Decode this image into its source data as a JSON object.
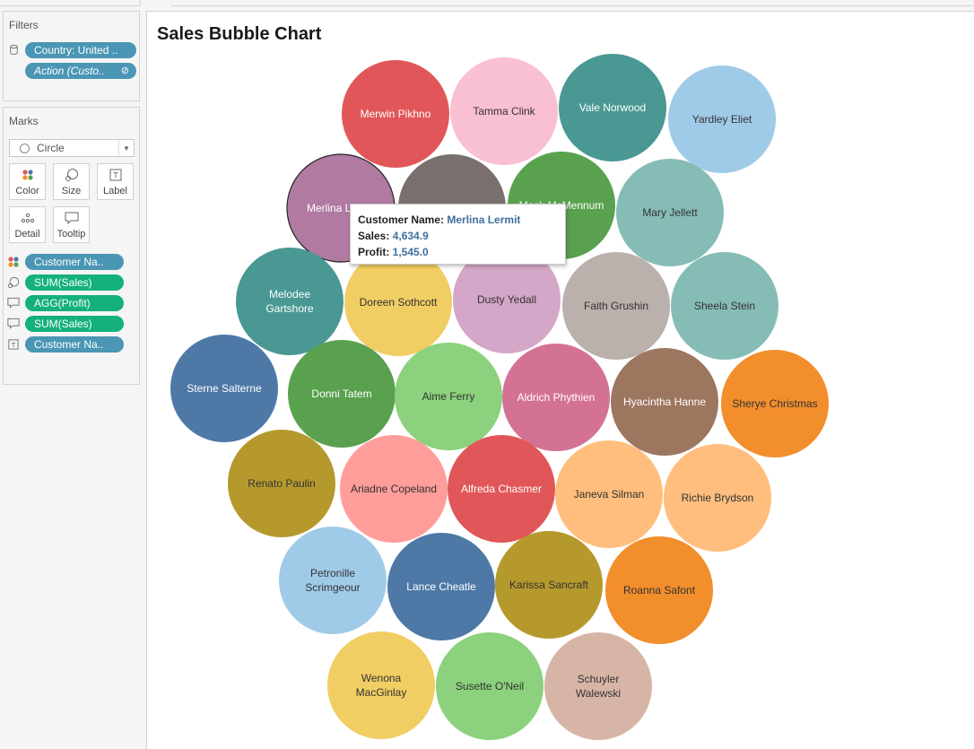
{
  "filters": {
    "title": "Filters",
    "items": [
      {
        "label": "Country: United ..",
        "style": "blue"
      },
      {
        "label": "Action (Custo..",
        "style": "blue-italic"
      }
    ]
  },
  "marks": {
    "title": "Marks",
    "type": "Circle",
    "buttons": [
      {
        "label": "Color",
        "icon": "color-dots-icon"
      },
      {
        "label": "Size",
        "icon": "size-icon"
      },
      {
        "label": "Label",
        "icon": "label-icon"
      },
      {
        "label": "Detail",
        "icon": "detail-icon"
      },
      {
        "label": "Tooltip",
        "icon": "tooltip-icon"
      }
    ],
    "fields": [
      {
        "label": "Customer Na..",
        "color": "blue",
        "icon": "color-dots-icon"
      },
      {
        "label": "SUM(Sales)",
        "color": "green",
        "icon": "size-icon"
      },
      {
        "label": "AGG(Profit)",
        "color": "green",
        "icon": "tooltip-icon"
      },
      {
        "label": "SUM(Sales)",
        "color": "green",
        "icon": "tooltip-icon"
      },
      {
        "label": "Customer Na..",
        "color": "blue",
        "icon": "label-icon"
      }
    ]
  },
  "chart_data": {
    "type": "bubble",
    "title": "Sales Bubble Chart",
    "bubbles": [
      {
        "name": "Merwin Pikhno",
        "color": "#e15759",
        "text": "#ffffff"
      },
      {
        "name": "Tamma Clink",
        "color": "#f9bfd3",
        "text": "#333333"
      },
      {
        "name": "Vale Norwood",
        "color": "#499894",
        "text": "#ffffff"
      },
      {
        "name": "Yardley Eliet",
        "color": "#a0cbe8",
        "text": "#333333"
      },
      {
        "name": "Merlina Lermit",
        "color": "#b07aa1",
        "text": "#ffffff",
        "highlighted": true
      },
      {
        "name": "",
        "color": "#79706e",
        "text": "#ffffff"
      },
      {
        "name": "Mack McMennum",
        "color": "#59a14f",
        "text": "#ffffff"
      },
      {
        "name": "Mary Jellett",
        "color": "#86bcb6",
        "text": "#333333"
      },
      {
        "name": "Melodee Gartshore",
        "color": "#499894",
        "text": "#ffffff"
      },
      {
        "name": "Doreen Sothcott",
        "color": "#f1ce63",
        "text": "#333333"
      },
      {
        "name": "Dusty Yedall",
        "color": "#d4a6c8",
        "text": "#333333"
      },
      {
        "name": "Faith Grushin",
        "color": "#bab0ac",
        "text": "#333333"
      },
      {
        "name": "Sheela Stein",
        "color": "#86bcb6",
        "text": "#333333"
      },
      {
        "name": "Sterne Salterne",
        "color": "#4e79a7",
        "text": "#ffffff"
      },
      {
        "name": "Donni Tatem",
        "color": "#59a14f",
        "text": "#ffffff"
      },
      {
        "name": "Aime Ferry",
        "color": "#8cd17d",
        "text": "#333333"
      },
      {
        "name": "Aldrich Phythien",
        "color": "#d37295",
        "text": "#ffffff"
      },
      {
        "name": "Hyacintha Hanne",
        "color": "#9d7660",
        "text": "#ffffff"
      },
      {
        "name": "Sherye Christmas",
        "color": "#f28e2b",
        "text": "#333333"
      },
      {
        "name": "Renato Paulin",
        "color": "#b6992d",
        "text": "#333333"
      },
      {
        "name": "Ariadne Copeland",
        "color": "#ff9d9a",
        "text": "#333333"
      },
      {
        "name": "Alfreda Chasmer",
        "color": "#e15759",
        "text": "#ffffff"
      },
      {
        "name": "Janeva Silman",
        "color": "#ffbe7d",
        "text": "#333333"
      },
      {
        "name": "Richie Brydson",
        "color": "#ffbe7d",
        "text": "#333333"
      },
      {
        "name": "Petronille Scrimgeour",
        "color": "#a0cbe8",
        "text": "#333333"
      },
      {
        "name": "Lance Cheatle",
        "color": "#4e79a7",
        "text": "#ffffff"
      },
      {
        "name": "Karissa Sancraft",
        "color": "#b6992d",
        "text": "#333333"
      },
      {
        "name": "Roanna Safont",
        "color": "#f28e2b",
        "text": "#333333"
      },
      {
        "name": "Wenona MacGinlay",
        "color": "#f1ce63",
        "text": "#333333"
      },
      {
        "name": "Susette O'Neil",
        "color": "#8cd17d",
        "text": "#333333"
      },
      {
        "name": "Schuyler Walewski",
        "color": "#d7b5a6",
        "text": "#333333"
      }
    ]
  },
  "tooltip": {
    "name_label": "Customer Name:",
    "name_value": "Merlina Lermit",
    "sales_label": "Sales:",
    "sales_value": "4,634.9",
    "profit_label": "Profit:",
    "profit_value": "1,545.0"
  }
}
